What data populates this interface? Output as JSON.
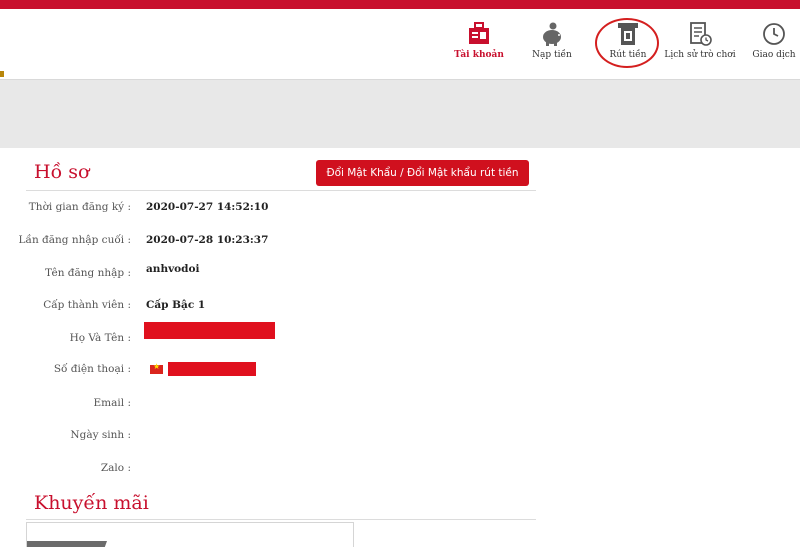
{
  "nav": {
    "items": [
      {
        "label": "Tài khoản",
        "icon": "account-card-icon",
        "active": true
      },
      {
        "label": "Nạp tiền",
        "icon": "piggy-bank-icon",
        "active": false
      },
      {
        "label": "Rút tiền",
        "icon": "atm-withdraw-icon",
        "active": false
      },
      {
        "label": "Lịch sử trò chơi",
        "icon": "history-document-icon",
        "active": false
      },
      {
        "label": "Giao dịch",
        "icon": "clock-icon",
        "active": false
      }
    ]
  },
  "profile": {
    "title": "Hồ sơ",
    "change_password_button": "Đổi Mật Khẩu / Đổi Mật khẩu rút tiền",
    "fields": {
      "registration_time": {
        "label": "Thời gian đăng ký :",
        "value": "2020-07-27 14:52:10"
      },
      "last_login": {
        "label": "Lần đăng nhập cuối :",
        "value": "2020-07-28 10:23:37"
      },
      "username": {
        "label": "Tên đăng nhập :",
        "value": "anhvodoi"
      },
      "member_level": {
        "label": "Cấp thành viên :",
        "value": "Cấp Bậc 1"
      },
      "full_name": {
        "label": "Họ Và Tên :",
        "value": ""
      },
      "phone": {
        "label": "Số điện thoại :",
        "value": ""
      },
      "email": {
        "label": "Email :",
        "value": ""
      },
      "birthday": {
        "label": "Ngày sinh :",
        "value": ""
      },
      "zalo": {
        "label": "Zalo :",
        "value": ""
      }
    }
  },
  "promotions": {
    "title": "Khuyến mãi"
  },
  "colors": {
    "brand_red": "#c8102e",
    "button_red": "#d0101e",
    "highlight_ring": "#d41f1f",
    "grey_band": "#e8e8e8"
  }
}
